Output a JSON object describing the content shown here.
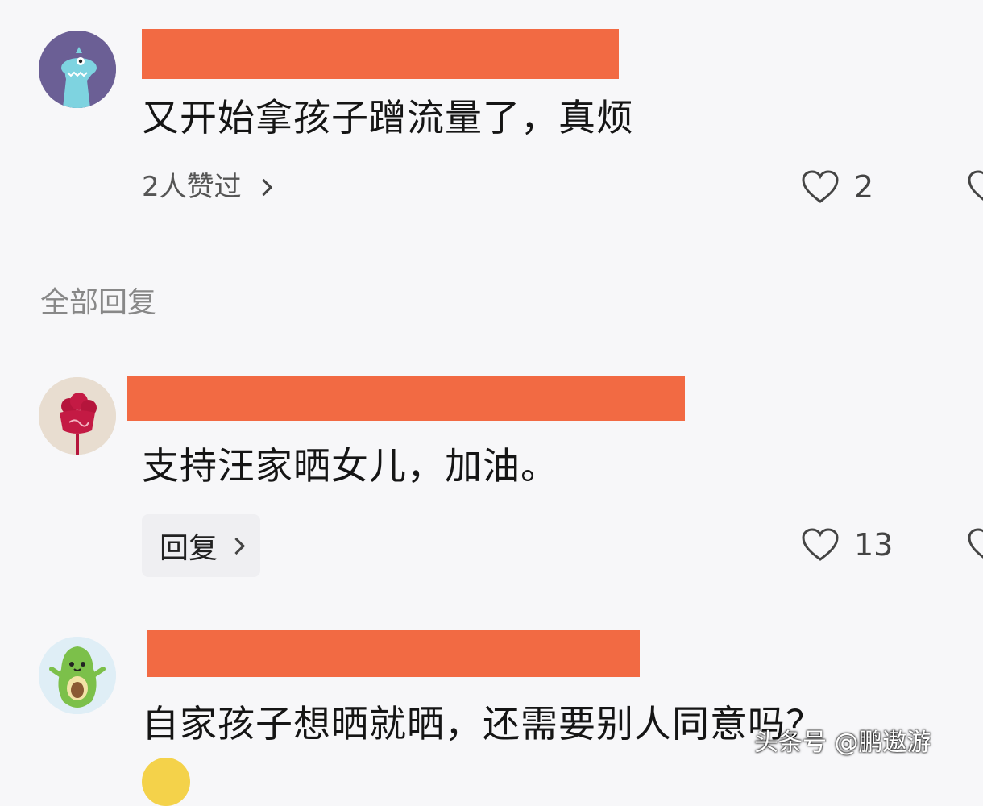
{
  "comments": [
    {
      "text": "又开始拿孩子蹭流量了，真烦",
      "likers_text": "2人赞过",
      "like_count": "2",
      "avatar_icon": "dinosaur-avatar"
    },
    {
      "text": "支持汪家晒女儿，加油。",
      "reply_label": "回复",
      "like_count": "13",
      "avatar_icon": "rose-avatar"
    },
    {
      "text": "自家孩子想晒就晒，还需要别人同意吗？",
      "avatar_icon": "avocado-avatar"
    }
  ],
  "replies_section_label": "全部回复",
  "watermark": "头条号 @鹏遨游",
  "colors": {
    "redaction": "#f26a43",
    "background": "#f7f7f9"
  }
}
